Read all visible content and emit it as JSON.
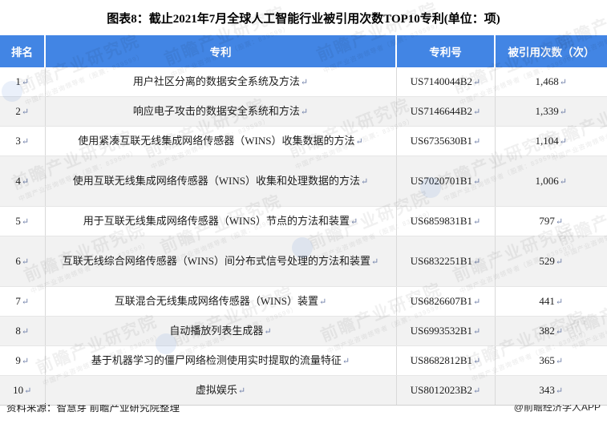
{
  "title": "图表8：截止2021年7月全球人工智能行业被引用次数TOP10专利(单位：项)",
  "table": {
    "headers": {
      "rank": "排名",
      "patent": "专利",
      "patent_no": "专利号",
      "citations": "被引用次数（次）"
    },
    "rows": [
      {
        "rank": "1",
        "patent": "用户社区分离的数据安全系统及方法",
        "patent_no": "US7140044B2",
        "citations": "1,468"
      },
      {
        "rank": "2",
        "patent": "响应电子攻击的数据安全系统和方法",
        "patent_no": "US7146644B2",
        "citations": "1,339"
      },
      {
        "rank": "3",
        "patent": "使用紧凑互联无线集成网络传感器（WINS）收集数据的方法",
        "patent_no": "US6735630B1",
        "citations": "1,104"
      },
      {
        "rank": "4",
        "patent": "使用互联无线集成网络传感器（WINS）收集和处理数据的方法",
        "patent_no": "US7020701B1",
        "citations": "1,006"
      },
      {
        "rank": "5",
        "patent": "用于互联无线集成网络传感器（WINS）节点的方法和装置",
        "patent_no": "US6859831B1",
        "citations": "797"
      },
      {
        "rank": "6",
        "patent": "互联无线综合网络传感器（WINS）间分布式信号处理的方法和装置",
        "patent_no": "US6832251B1",
        "citations": "529"
      },
      {
        "rank": "7",
        "patent": "互联混合无线集成网络传感器（WINS）装置",
        "patent_no": "US6826607B1",
        "citations": "441"
      },
      {
        "rank": "8",
        "patent": "自动播放列表生成器",
        "patent_no": "US6993532B1",
        "citations": "382"
      },
      {
        "rank": "9",
        "patent": "基于机器学习的僵尸网络检测使用实时提取的流量特征",
        "patent_no": "US8682812B1",
        "citations": "365"
      },
      {
        "rank": "10",
        "patent": "虚拟娱乐",
        "patent_no": "US8012023B2",
        "citations": "343"
      }
    ]
  },
  "footer": {
    "source": "资料来源：智慧芽 前瞻产业研究院整理",
    "attribution": "@前瞻经济学人APP"
  },
  "watermark": {
    "main": "前瞻产业研究院",
    "sub": "中国产业咨询领导者（股票：839599）"
  },
  "colors": {
    "header_blue": "#4285e4",
    "alt_row": "#f2f2f2",
    "text": "#1c1c1c"
  },
  "symbols": {
    "paragraph_mark": "↵"
  }
}
